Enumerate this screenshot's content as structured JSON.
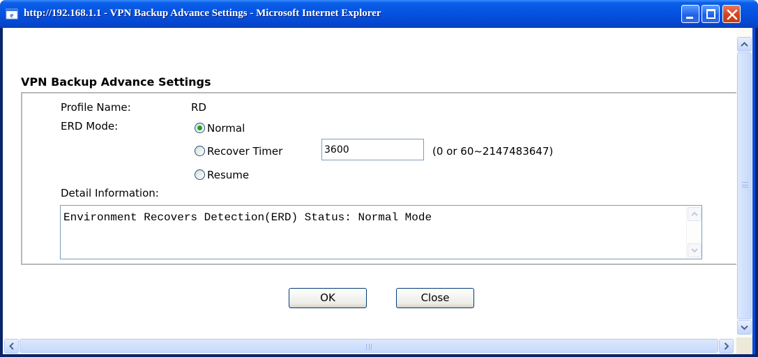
{
  "window": {
    "title": "http://192.168.1.1 - VPN Backup Advance Settings - Microsoft Internet Explorer"
  },
  "page": {
    "heading": "VPN Backup Advance Settings",
    "profile_name_label": "Profile Name:",
    "profile_name_value": "RD",
    "erd_mode_label": "ERD Mode:",
    "erd_options": [
      {
        "label": "Normal",
        "selected": true
      },
      {
        "label": "Recover Timer",
        "selected": false
      },
      {
        "label": "Resume",
        "selected": false
      }
    ],
    "recover_timer_value": "3600",
    "recover_timer_hint": "(0 or 60~2147483647)",
    "detail_label": "Detail Information:",
    "detail_text": "Environment Recovers Detection(ERD) Status: Normal Mode"
  },
  "buttons": {
    "ok_label": "OK",
    "close_label": "Close"
  },
  "colors": {
    "titlebar": "#0551e0",
    "radio_selected": "#21a121",
    "panel_border": "#b8b8b8"
  }
}
